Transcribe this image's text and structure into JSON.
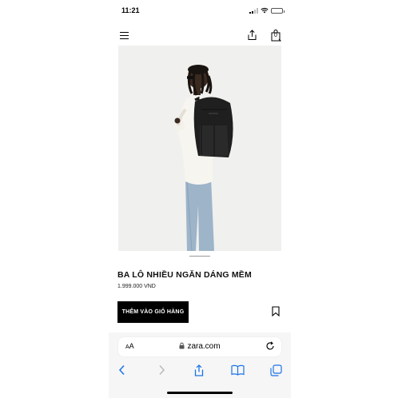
{
  "status_bar": {
    "time": "11:21"
  },
  "header": {
    "menu_icon": "hamburger-menu-icon",
    "share_icon": "share-icon",
    "bag_icon": "shopping-bag-icon",
    "bag_count": "0"
  },
  "product": {
    "image_alt": "Man wearing black backpack",
    "title": "BA LÔ NHIỀU NGĂN DÁNG MỀM",
    "price": "1.999.000 VND",
    "add_to_cart_label": "THÊM VÀO GIỎ HÀNG",
    "bookmark_icon": "bookmark-icon"
  },
  "browser": {
    "aa_label_small": "A",
    "aa_label_large": "A",
    "url": "zara.com",
    "lock_icon": "lock-icon",
    "reload_icon": "reload-icon",
    "nav": [
      "back-icon",
      "forward-icon",
      "share-icon",
      "bookmarks-icon",
      "tabs-icon"
    ]
  },
  "colors": {
    "button_bg": "#000000",
    "image_bg": "#f0f0ee",
    "browser_bg": "#f6f6f6"
  }
}
